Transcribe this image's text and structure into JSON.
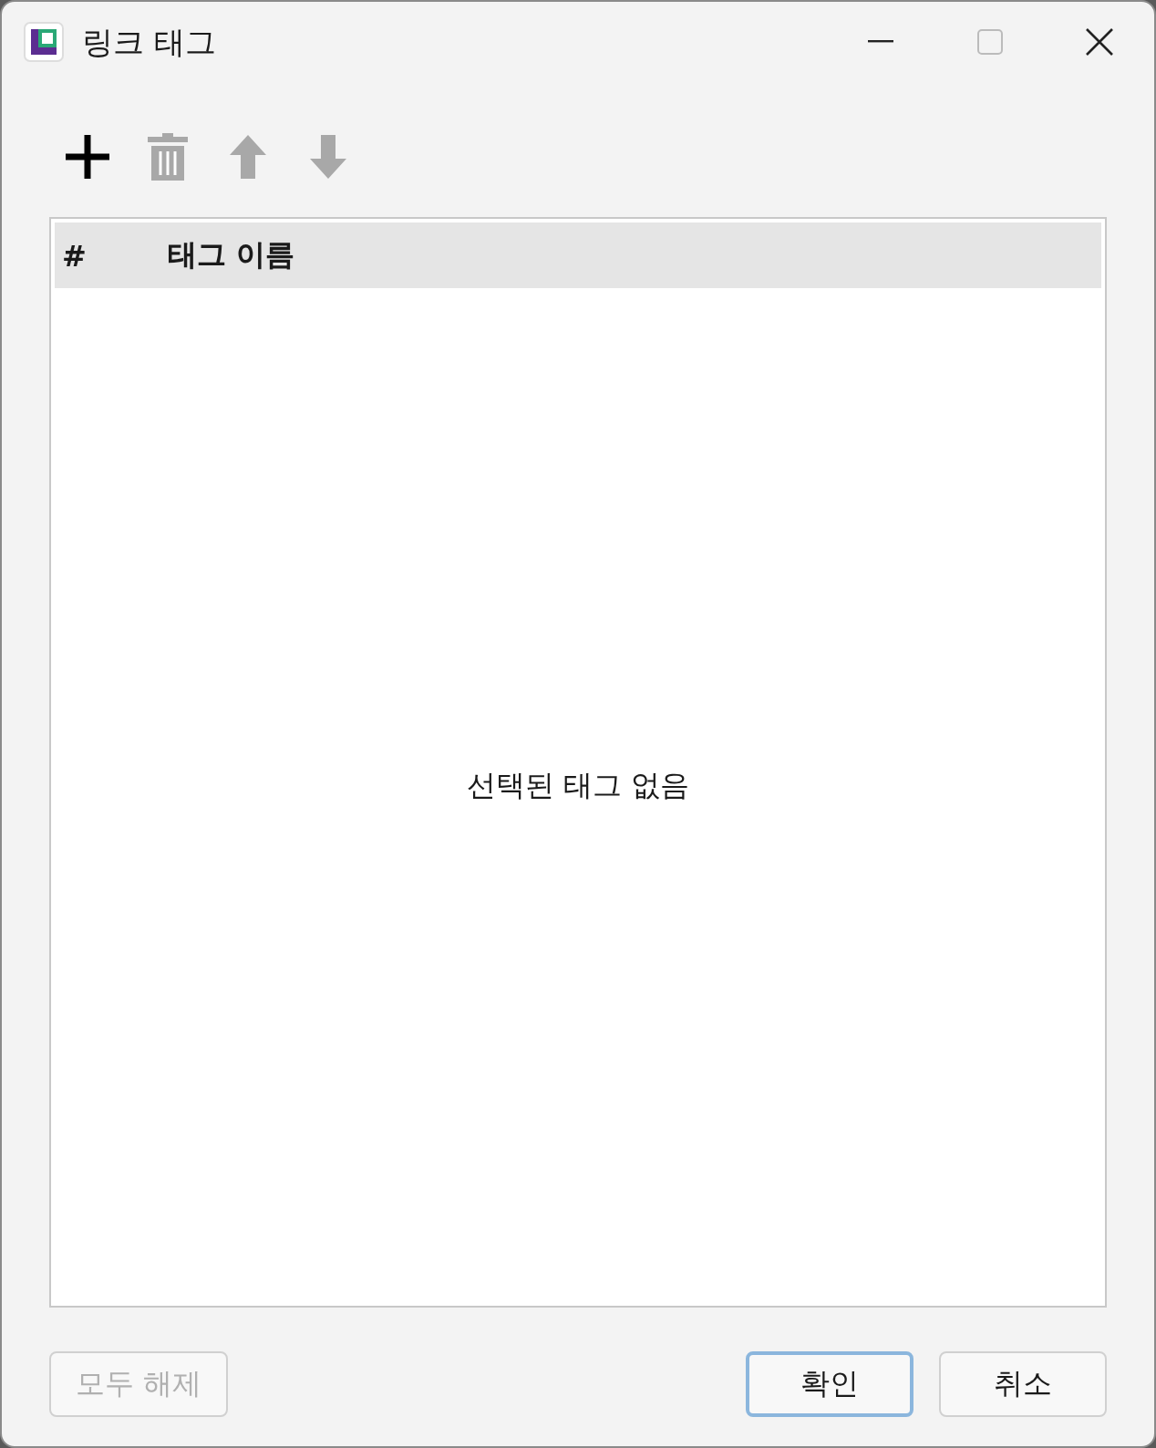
{
  "window": {
    "title": "링크 태그"
  },
  "toolbar": [
    {
      "kind": "add",
      "disabled": false
    },
    {
      "kind": "delete",
      "disabled": true
    },
    {
      "kind": "up",
      "disabled": true
    },
    {
      "kind": "down",
      "disabled": true
    }
  ],
  "table": {
    "columns": [
      "#",
      "태그 이름"
    ],
    "empty_message": "선택된 태그 없음"
  },
  "buttons": [
    {
      "label": "모두 해제",
      "disabled": true,
      "default": false
    },
    {
      "label": "확인",
      "disabled": false,
      "default": true
    },
    {
      "label": "취소",
      "disabled": false,
      "default": false
    }
  ]
}
